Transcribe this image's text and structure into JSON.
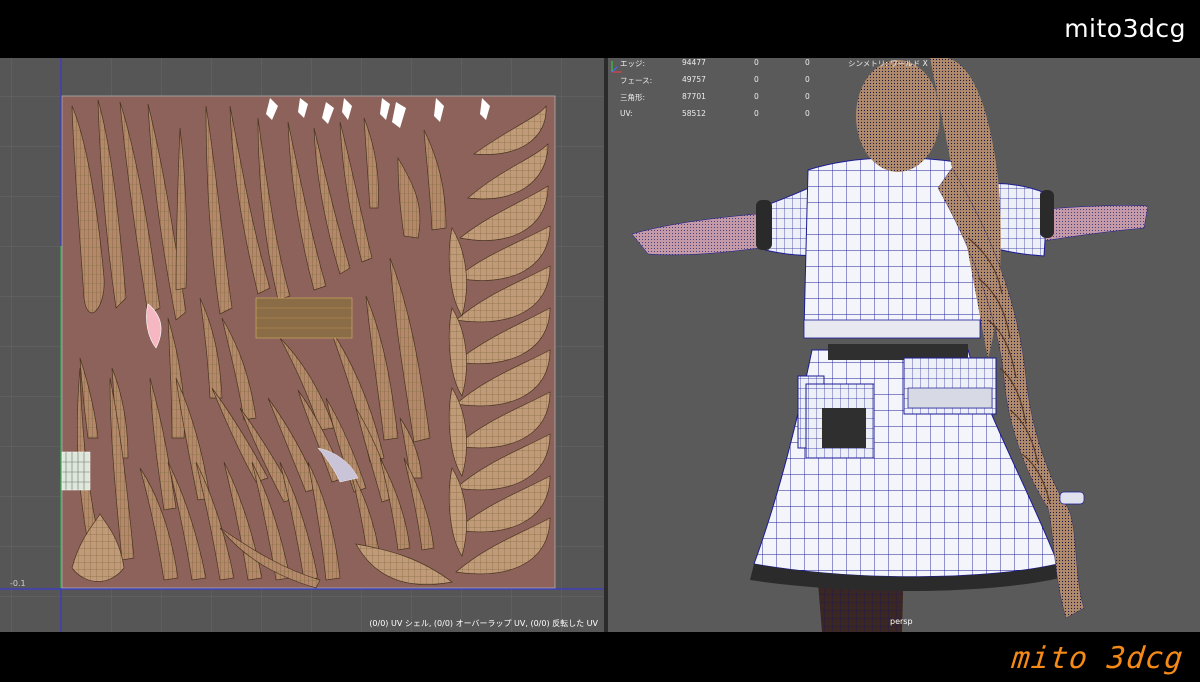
{
  "watermark": {
    "top": "mito3dcg",
    "bottom": "mito 3dcg"
  },
  "uv_editor": {
    "status_text": "(0/0) UV シェル, (0/0) オーバーラップ UV, (0/0) 反転した UV",
    "coordinate_label": "-0.1"
  },
  "viewport": {
    "camera_label": "persp",
    "symmetry_label": "シンメトリ: ワールド X",
    "poly_stats": [
      {
        "label": "エッジ:",
        "value": "94477",
        "selected": "0",
        "extra": "0"
      },
      {
        "label": "フェース:",
        "value": "49757",
        "selected": "0",
        "extra": "0"
      },
      {
        "label": "三角形:",
        "value": "87701",
        "selected": "0",
        "extra": "0"
      },
      {
        "label": "UV:",
        "value": "58512",
        "selected": "0",
        "extra": "0"
      }
    ]
  },
  "colors": {
    "uv_bg": "#8d625a",
    "hair": "#b88e6e",
    "wire": "#1b1b95",
    "cloth": "#f4f5fb",
    "panel": "#565656",
    "watermark_hand": "#f58a16"
  }
}
